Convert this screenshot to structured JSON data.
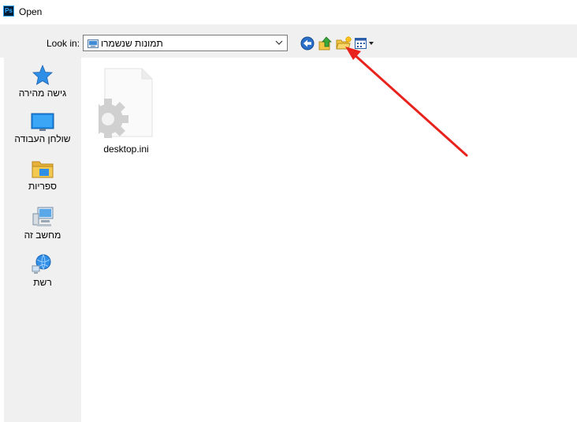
{
  "window": {
    "title": "Open",
    "app_icon_text": "Ps"
  },
  "toolbar": {
    "look_in_label": "Look in:",
    "look_in_value": "תמונות שנשמרו",
    "buttons": [
      {
        "name": "back",
        "icon": "back-arrow-icon"
      },
      {
        "name": "up-one-level",
        "icon": "folder-up-icon"
      },
      {
        "name": "create-new-folder",
        "icon": "new-folder-icon"
      },
      {
        "name": "view-menu",
        "icon": "views-menu-icon"
      }
    ]
  },
  "sidebar": {
    "places": [
      {
        "label": "גישה מהירה",
        "icon": "star-icon"
      },
      {
        "label": "שולחן העבודה",
        "icon": "desktop-icon"
      },
      {
        "label": "ספריות",
        "icon": "libraries-folder-icon"
      },
      {
        "label": "מחשב זה",
        "icon": "computer-icon"
      },
      {
        "label": "רשת",
        "icon": "network-icon"
      }
    ]
  },
  "files": [
    {
      "name": "desktop.ini",
      "icon": "settings-file-icon"
    }
  ],
  "annotation": {
    "type": "arrow",
    "color": "#e8231e",
    "target": "create-new-folder"
  },
  "colors": {
    "panel": "#f0f0f0",
    "arrow": "#e8231e",
    "accent": "#1e6fd9"
  }
}
